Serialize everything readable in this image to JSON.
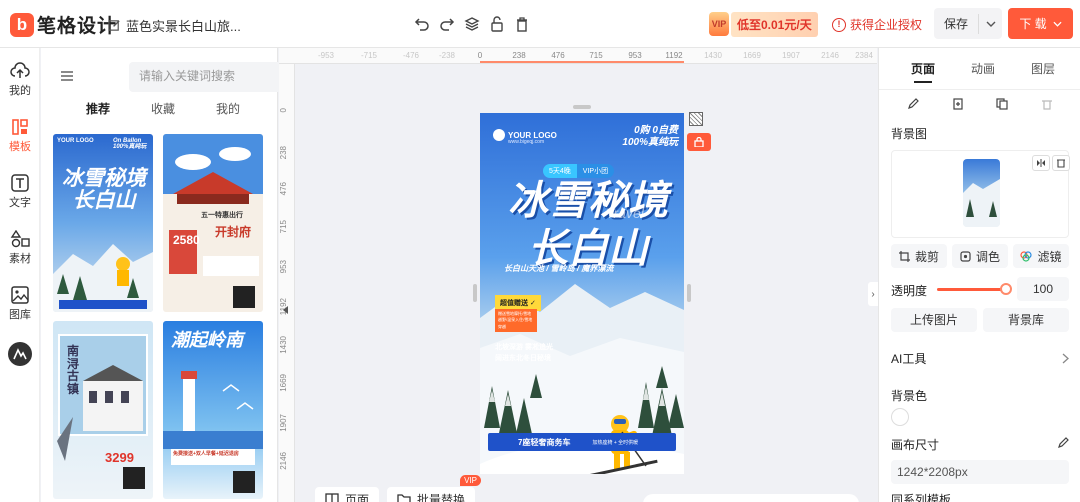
{
  "app": {
    "logo_mark": "b",
    "logo_text": "笔格设计",
    "doc_title": "蓝色实景长白山旅...",
    "promo_badge": "VIP",
    "promo_text": "低至0.01元/天",
    "enterprise_label": "获得企业授权",
    "save_label": "保存",
    "download_label": "下 载",
    "accent": "#ff5a3a"
  },
  "rail": [
    {
      "label": "我的",
      "icon": "cloud-upload-icon"
    },
    {
      "label": "模板",
      "icon": "template-icon"
    },
    {
      "label": "文字",
      "icon": "text-icon"
    },
    {
      "label": "素材",
      "icon": "shapes-icon"
    },
    {
      "label": "图库",
      "icon": "image-icon"
    }
  ],
  "panel": {
    "search_placeholder": "请输入关键词搜索",
    "tabs": [
      "推荐",
      "收藏",
      "我的"
    ],
    "cards": [
      {
        "title": "冰雪秘境长白山",
        "sub": "On Ballon 100%真纯玩"
      },
      {
        "title": "开封府",
        "sub": "五一特惠出行",
        "price": "2580"
      },
      {
        "title": "南浔古镇",
        "price": "3299"
      },
      {
        "title": "潮起岭南",
        "sub": "免费接送+双人早餐+延迟退房"
      }
    ]
  },
  "ruler": {
    "top": [
      "-953",
      "-715",
      "-476",
      "-238",
      "0",
      "238",
      "476",
      "715",
      "953",
      "1192",
      "1430",
      "1669",
      "1907",
      "2146",
      "2384"
    ],
    "left": [
      "0",
      "238",
      "476",
      "715",
      "953",
      "1192",
      "1430",
      "1669",
      "1907",
      "2146"
    ]
  },
  "poster": {
    "logo": "YOUR LOGO",
    "url": "www.bigeqj.com",
    "top_right_1": "0购 0自费",
    "top_right_2": "100%真纯玩",
    "tag_a": "5天4晚",
    "tag_b": "VIP小团",
    "title_1": "冰雪秘境",
    "title_2": "长白山",
    "travel": "Travel",
    "route": "长白山天池 / 雪岭岛 / 魔界漂流",
    "gift": "超值赠送 ✓",
    "gift_list": "赠送雪地摩托/雪地越野/温泉入住/雪地穿越",
    "desc_1": "北坡深游 雾凇追光",
    "desc_2": "阔进东北冬日秘境",
    "bottom_a": "7座轻奢商务车",
    "bottom_b": "加热座椅 + 全时供暖"
  },
  "canvas_bar": {
    "btn1": "页面",
    "btn2": "批量替换",
    "vip": "VIP"
  },
  "right": {
    "tabs": [
      "页面",
      "动画",
      "图层"
    ],
    "bg_image_label": "背景图",
    "crop_label": "裁剪",
    "tone_label": "调色",
    "filter_label": "滤镜",
    "opacity_label": "透明度",
    "opacity_value": "100",
    "opacity": 1.0,
    "upload_label": "上传图片",
    "bg_lib_label": "背景库",
    "ai_label": "AI工具",
    "bg_color_label": "背景色",
    "canvas_size_label": "画布尺寸",
    "canvas_size_value": "1242*2208px",
    "series_label": "同系列模板"
  }
}
